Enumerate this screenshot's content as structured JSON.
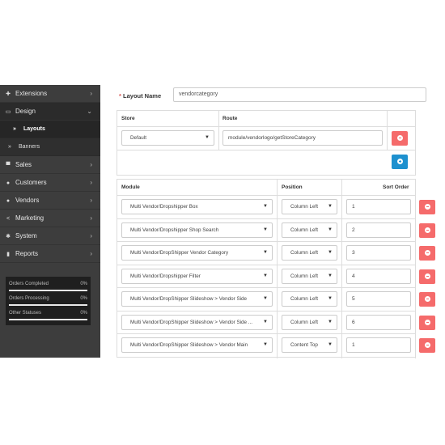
{
  "sidebar": {
    "items": [
      {
        "label": "Extensions",
        "icon": "puzzle-icon",
        "glyph": "✚"
      },
      {
        "label": "Design",
        "icon": "monitor-icon",
        "glyph": "▭",
        "expanded": true,
        "children": [
          {
            "label": "Layouts",
            "active": true
          },
          {
            "label": "Banners",
            "active": false
          }
        ]
      },
      {
        "label": "Sales",
        "icon": "cart-icon",
        "glyph": "▀"
      },
      {
        "label": "Customers",
        "icon": "user-icon",
        "glyph": "●"
      },
      {
        "label": "Vendors",
        "icon": "users-icon",
        "glyph": "●"
      },
      {
        "label": "Marketing",
        "icon": "share-icon",
        "glyph": "<"
      },
      {
        "label": "System",
        "icon": "gear-icon",
        "glyph": "✱"
      },
      {
        "label": "Reports",
        "icon": "bar-chart-icon",
        "glyph": "▮"
      }
    ],
    "stats": [
      {
        "label": "Orders Completed",
        "percent": "0%"
      },
      {
        "label": "Orders Processing",
        "percent": "0%"
      },
      {
        "label": "Other Statuses",
        "percent": "0%"
      }
    ]
  },
  "form": {
    "layout_name_label": "Layout Name",
    "required_mark": "*",
    "layout_name_value": "vendorcategory"
  },
  "routes": {
    "headers": {
      "store": "Store",
      "route": "Route"
    },
    "rows": [
      {
        "store": "Default",
        "route": "module/vendorlogo/getStoreCategory"
      }
    ]
  },
  "modules": {
    "headers": {
      "module": "Module",
      "position": "Position",
      "sort_order": "Sort Order"
    },
    "rows": [
      {
        "module": "Multi Vendor/Dropshipper Box",
        "position": "Column Left",
        "sort_order": "1"
      },
      {
        "module": "Multi Vendor/Dropshipper Shop Search",
        "position": "Column Left",
        "sort_order": "2"
      },
      {
        "module": "Multi Vendor/DropShipper Vendor Category",
        "position": "Column Left",
        "sort_order": "3"
      },
      {
        "module": "Multi Vendor/Dropshipper Filter",
        "position": "Column Left",
        "sort_order": "4"
      },
      {
        "module": "Multi Vendor/DropShipper Slideshow > Vendor Side",
        "position": "Column Left",
        "sort_order": "5"
      },
      {
        "module": "Multi Vendor/DropShipper Slideshow > Vendor Side ...",
        "position": "Column Left",
        "sort_order": "6"
      },
      {
        "module": "Multi Vendor/DropShipper Slideshow > Vendor Main",
        "position": "Content Top",
        "sort_order": "1"
      }
    ]
  },
  "colors": {
    "danger": "#f56b6b",
    "primary": "#1e91cf",
    "sidebar": "#3d3d3d"
  }
}
